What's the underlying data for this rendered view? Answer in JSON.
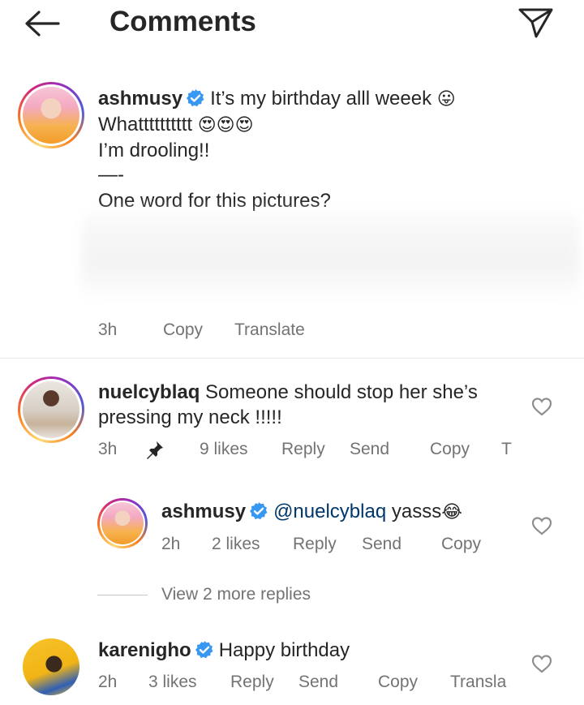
{
  "header": {
    "title": "Comments",
    "back_icon": "back-arrow-icon",
    "send_icon": "paper-plane-icon"
  },
  "caption": {
    "username": "ashmusy",
    "line1": "It’s my birthday alll weeek",
    "line1_emoji": "😛",
    "line2": "Whatttttttttt",
    "line2_emoji": "😍😍😍",
    "line3": "I’m drooling!!",
    "line4": "—-",
    "line5": "One word for this pictures?",
    "time": "3h",
    "copy": "Copy",
    "translate": "Translate"
  },
  "comments": [
    {
      "username": "nuelcyblaq",
      "text_line1": "Someone should stop her she’s",
      "text_line2": "pressing my neck !!!!!",
      "time": "3h",
      "likes": "9 likes",
      "reply": "Reply",
      "send": "Send",
      "copy": "Copy",
      "translate_cut": "T",
      "pinned": true,
      "reply_item": {
        "username": "ashmusy",
        "mention": "@nuelcyblaq",
        "text": "yasss",
        "emoji": "😂",
        "time": "2h",
        "likes": "2 likes",
        "reply": "Reply",
        "send": "Send",
        "copy": "Copy"
      },
      "view_more": "View 2 more replies"
    },
    {
      "username": "karenigho",
      "text": "Happy birthday",
      "time": "2h",
      "likes": "3 likes",
      "reply": "Reply",
      "send": "Send",
      "copy": "Copy",
      "translate_cut": "Transla"
    }
  ],
  "colors": {
    "verified": "#3897f0",
    "text": "#262626",
    "meta": "#737373",
    "mention": "#00376b"
  }
}
